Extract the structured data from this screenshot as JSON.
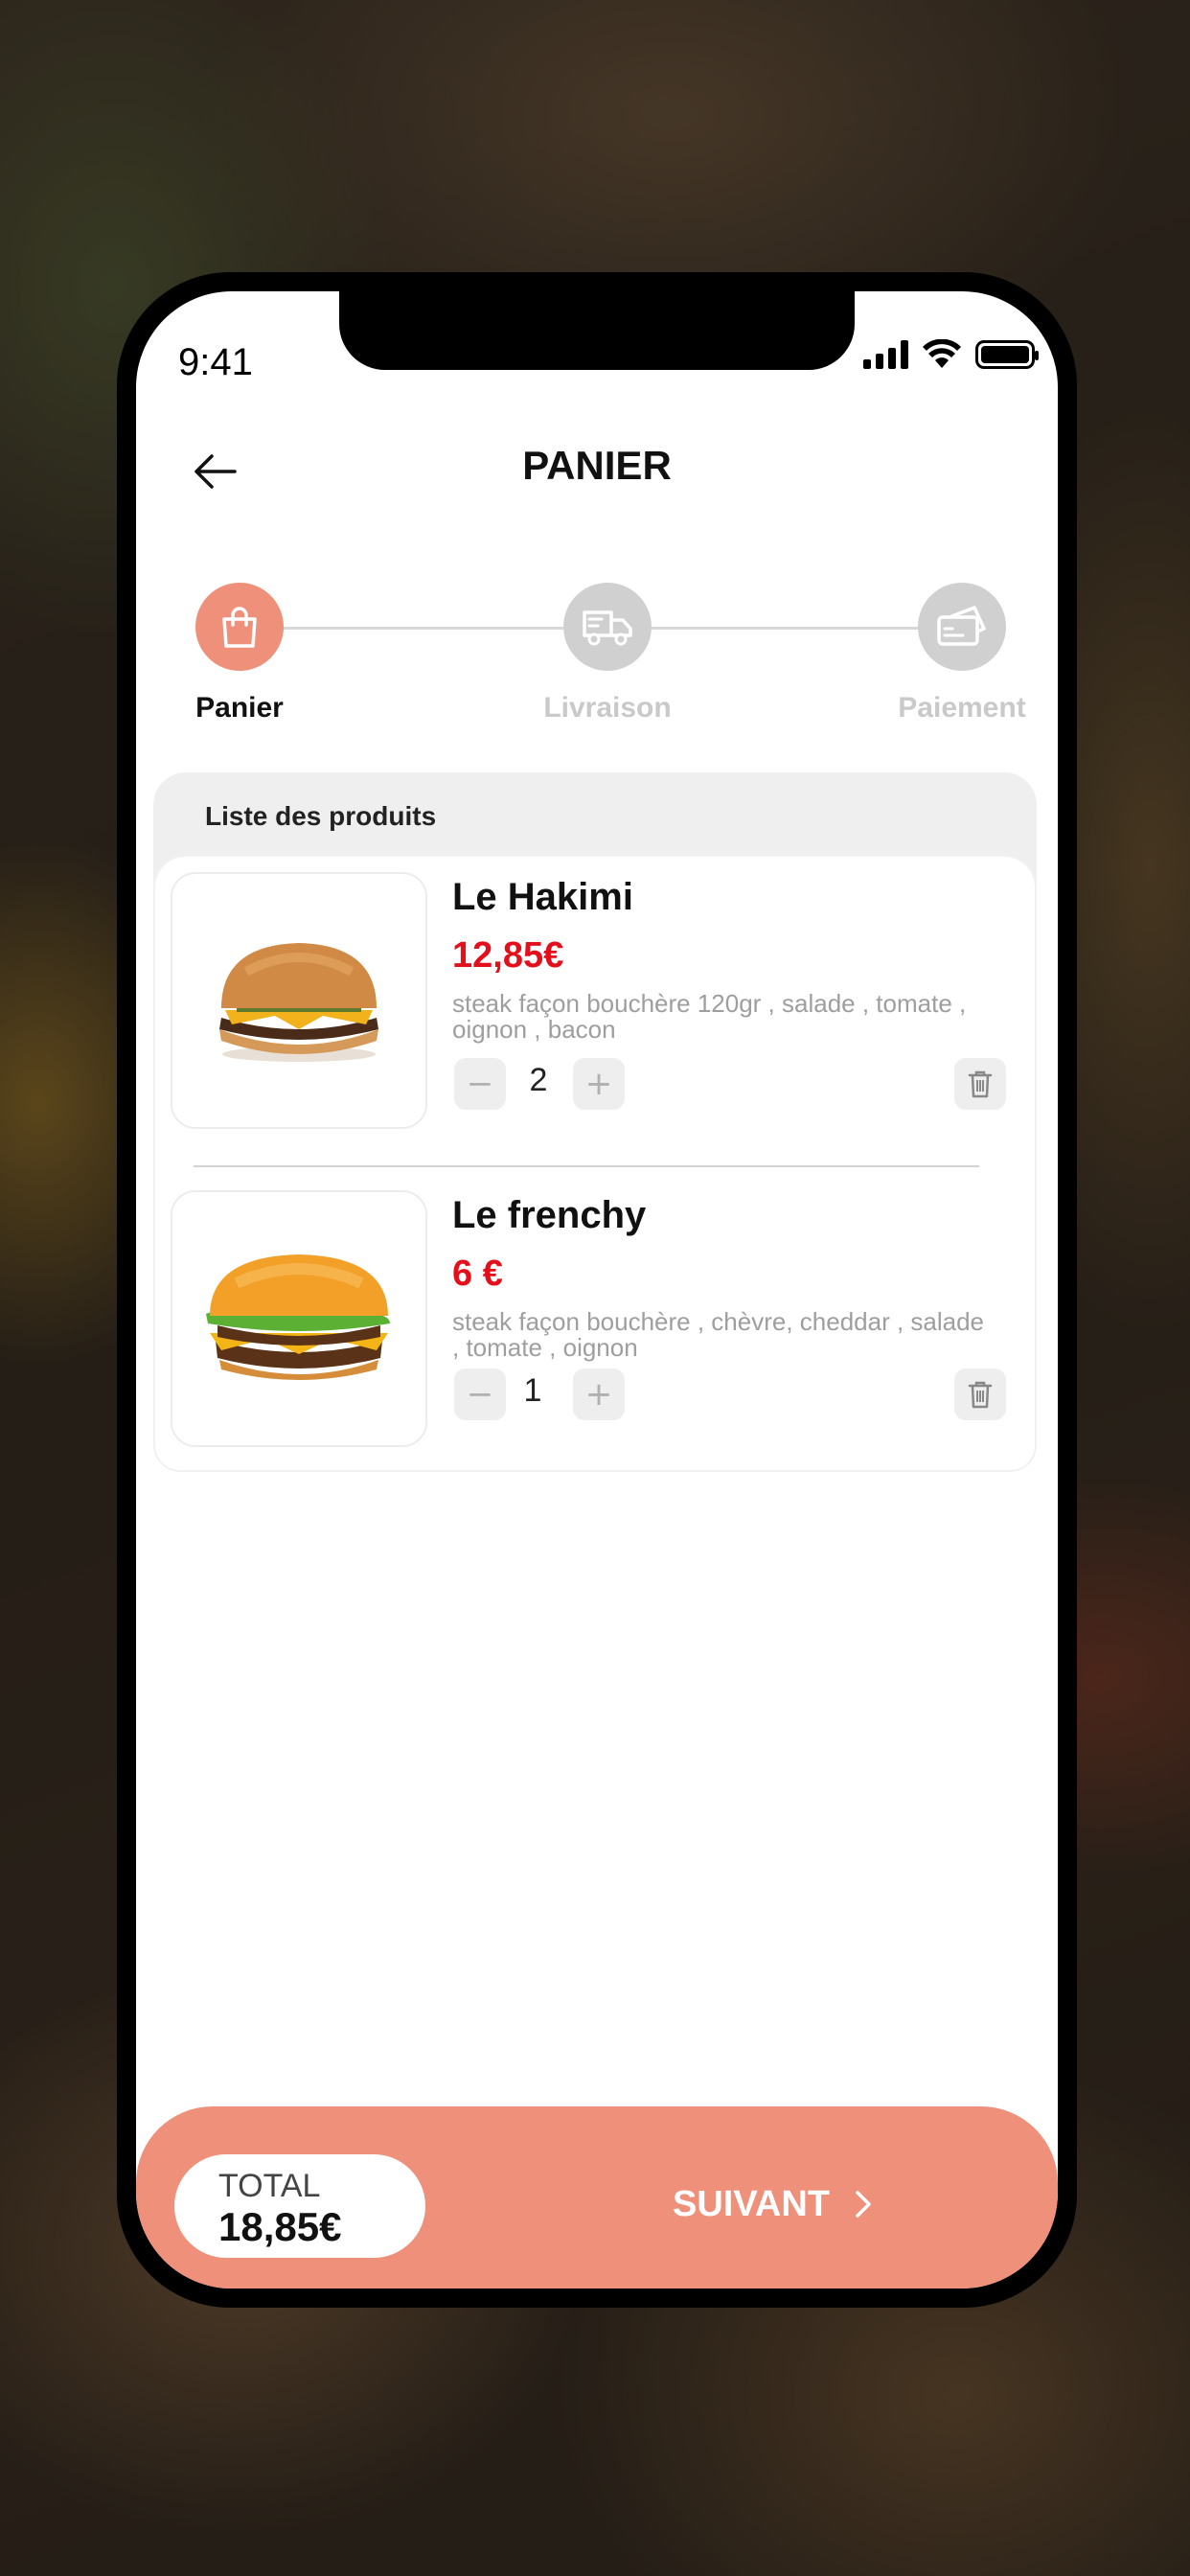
{
  "status_bar": {
    "time": "9:41"
  },
  "header": {
    "title": "PANIER"
  },
  "steps": [
    {
      "label": "Panier",
      "active": true,
      "icon": "shopping-bag-icon"
    },
    {
      "label": "Livraison",
      "active": false,
      "icon": "delivery-truck-icon"
    },
    {
      "label": "Paiement",
      "active": false,
      "icon": "credit-card-icon"
    }
  ],
  "cart": {
    "title": "Liste des produits",
    "items": [
      {
        "name": "Le Hakimi",
        "price": "12,85€",
        "description": "steak façon bouchère 120gr , salade , tomate , oignon , bacon",
        "quantity": "2"
      },
      {
        "name": "Le frenchy",
        "price": "6 €",
        "description": "steak façon bouchère , chèvre, cheddar , salade , tomate , oignon",
        "quantity": "1"
      }
    ]
  },
  "footer": {
    "total_label": "TOTAL",
    "total_value": "18,85€",
    "next_label": "SUIVANT"
  },
  "colors": {
    "accent": "#ef907a",
    "price": "#e3101c",
    "inactive": "#d0d0d0"
  }
}
